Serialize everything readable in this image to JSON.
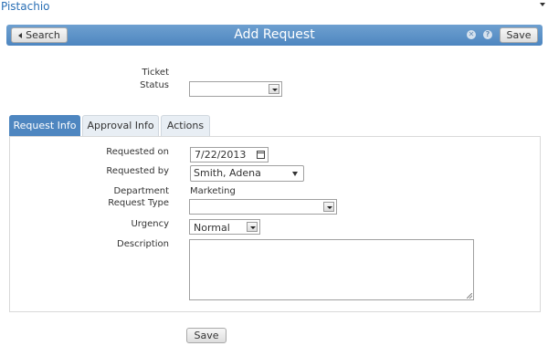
{
  "app": {
    "name": "Pistachio"
  },
  "toolbar": {
    "back_label": "Search",
    "title": "Add Request",
    "save_label": "Save"
  },
  "header_fields": {
    "ticket_label": "Ticket",
    "status_label": "Status",
    "status_value": ""
  },
  "tabs": [
    {
      "label": "Request Info",
      "active": true
    },
    {
      "label": "Approval Info",
      "active": false
    },
    {
      "label": "Actions",
      "active": false
    }
  ],
  "form": {
    "requested_on_label": "Requested on",
    "requested_on_value": "7/22/2013",
    "requested_by_label": "Requested by",
    "requested_by_value": "Smith, Adena",
    "department_label": "Department",
    "department_value": "Marketing",
    "request_type_label": "Request Type",
    "request_type_value": "",
    "urgency_label": "Urgency",
    "urgency_value": "Normal",
    "description_label": "Description",
    "description_value": ""
  },
  "footer": {
    "save_label": "Save"
  },
  "colors": {
    "accent": "#4e86c0",
    "link": "#2a6fb5"
  }
}
